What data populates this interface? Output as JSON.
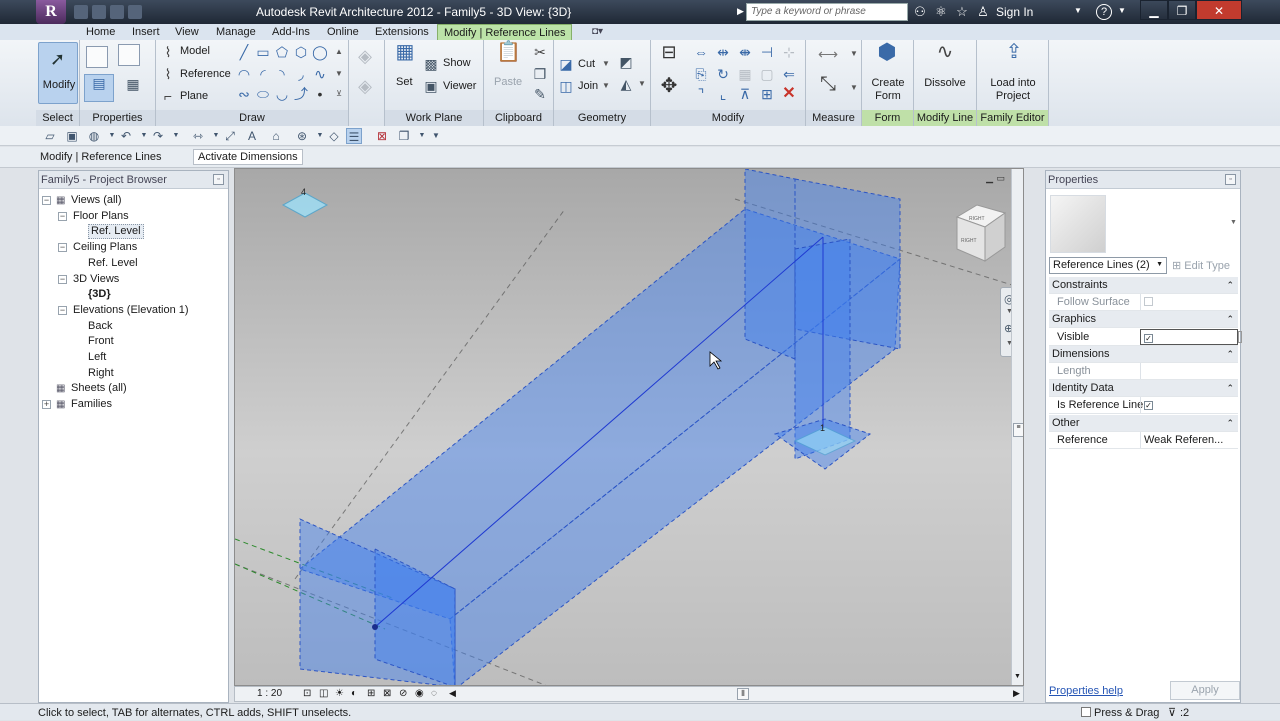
{
  "app": {
    "title": "Autodesk Revit Architecture 2012 -     Family5 - 3D View: {3D}",
    "logo_letter": "R",
    "search_placeholder": "Type a keyword or phrase",
    "sign_in": "Sign In"
  },
  "tabs": [
    "Home",
    "Insert",
    "View",
    "Manage",
    "Add-Ins",
    "Online",
    "Extensions"
  ],
  "active_tab": "Modify | Reference Lines",
  "ribbon": {
    "modify_label": "Modify",
    "properties_label": "Properties",
    "draw": {
      "model": "Model",
      "reference": "Reference",
      "plane": "Plane"
    },
    "workplane": {
      "set": "Set",
      "show": "Show",
      "viewer": "Viewer"
    },
    "clipboard": {
      "paste": "Paste"
    },
    "geometry": {
      "cut": "Cut",
      "join": "Join"
    },
    "form": {
      "create_form": [
        "Create",
        "Form"
      ]
    },
    "modify_line": {
      "dissolve": "Dissolve"
    },
    "family_editor": {
      "load": [
        "Load into",
        "Project"
      ]
    },
    "panels": [
      "Select",
      "Properties",
      "Draw",
      "Work Plane",
      "Clipboard",
      "Geometry",
      "Modify",
      "Measure",
      "Form",
      "Modify Line",
      "Family Editor"
    ]
  },
  "option_bar": {
    "context": "Modify | Reference Lines",
    "activate_dimensions": "Activate Dimensions"
  },
  "project_browser": {
    "title": "Family5 - Project Browser",
    "tree": [
      {
        "label": "Views (all)",
        "level": 0,
        "expander": "-"
      },
      {
        "label": "Floor Plans",
        "level": 1,
        "expander": "-"
      },
      {
        "label": "Ref. Level",
        "level": 2,
        "selected": true
      },
      {
        "label": "Ceiling Plans",
        "level": 1,
        "expander": "-"
      },
      {
        "label": "Ref. Level",
        "level": 2
      },
      {
        "label": "3D Views",
        "level": 1,
        "expander": "-"
      },
      {
        "label": "{3D}",
        "level": 2,
        "bold": true
      },
      {
        "label": "Elevations (Elevation 1)",
        "level": 1,
        "expander": "-"
      },
      {
        "label": "Back",
        "level": 2
      },
      {
        "label": "Front",
        "level": 2
      },
      {
        "label": "Left",
        "level": 2
      },
      {
        "label": "Right",
        "level": 2
      },
      {
        "label": "Sheets (all)",
        "level": 0
      },
      {
        "label": "Families",
        "level": 0,
        "expander": "+"
      }
    ]
  },
  "viewport": {
    "scale": "1 : 20",
    "viewcube": {
      "top": "RIGHT",
      "front": "RIGHT"
    },
    "labels": [
      "4",
      "1"
    ]
  },
  "properties": {
    "title": "Properties",
    "type_selector": "Reference Lines (2)",
    "edit_type": "Edit Type",
    "rows": [
      {
        "kind": "category",
        "label": "Constraints"
      },
      {
        "kind": "param",
        "label": "Follow Surface",
        "checkbox": false,
        "disabled": true
      },
      {
        "kind": "category",
        "label": "Graphics"
      },
      {
        "kind": "param",
        "label": "Visible",
        "checkbox": true
      },
      {
        "kind": "category",
        "label": "Dimensions"
      },
      {
        "kind": "param",
        "label": "Length",
        "value": "",
        "disabled": true
      },
      {
        "kind": "category",
        "label": "Identity Data"
      },
      {
        "kind": "param",
        "label": "Is Reference Line",
        "checkbox": true
      },
      {
        "kind": "category",
        "label": "Other"
      },
      {
        "kind": "param",
        "label": "Reference",
        "value": "Weak Referen..."
      }
    ],
    "help": "Properties help",
    "apply": "Apply"
  },
  "status": {
    "text": "Click to select, TAB for alternates, CTRL adds, SHIFT unselects.",
    "press_drag": "Press & Drag",
    "filter_count": ":2"
  }
}
